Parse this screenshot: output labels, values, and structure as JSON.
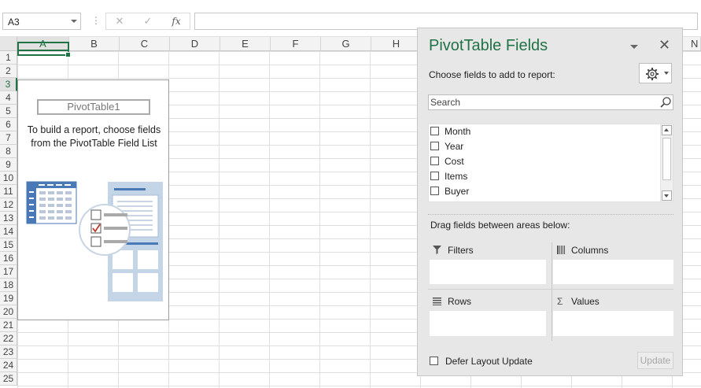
{
  "name_box": {
    "value": "A3"
  },
  "formula_bar": {
    "cancel_glyph": "✕",
    "enter_glyph": "✓",
    "fx_label": "fx",
    "formula": ""
  },
  "columns": [
    "A",
    "B",
    "C",
    "D",
    "E",
    "F",
    "G",
    "H",
    "N"
  ],
  "rows": [
    "1",
    "2",
    "3",
    "4",
    "5",
    "6",
    "7",
    "8",
    "9",
    "10",
    "11",
    "12",
    "13",
    "14",
    "15",
    "16",
    "17",
    "18",
    "19",
    "20",
    "21",
    "22",
    "23",
    "24",
    "25"
  ],
  "selected_cell": "A3",
  "pivot_placeholder": {
    "name": "PivotTable1",
    "instructions_line1": "To build a report, choose fields",
    "instructions_line2": "from the PivotTable Field List"
  },
  "pivot_panel": {
    "title": "PivotTable Fields",
    "subtitle": "Choose fields to add to report:",
    "search_placeholder": "Search",
    "fields": [
      {
        "label": "Month",
        "checked": false
      },
      {
        "label": "Year",
        "checked": false
      },
      {
        "label": "Cost",
        "checked": false
      },
      {
        "label": "Items",
        "checked": false
      },
      {
        "label": "Buyer",
        "checked": false
      }
    ],
    "drag_label": "Drag fields between areas below:",
    "areas": {
      "filters": "Filters",
      "columns": "Columns",
      "rows": "Rows",
      "values": "Values"
    },
    "defer_label": "Defer Layout Update",
    "update_button": "Update"
  },
  "colors": {
    "accent": "#217346",
    "panel_bg": "#e7e7e7",
    "placeholder_blue": "#4a7ab5"
  }
}
